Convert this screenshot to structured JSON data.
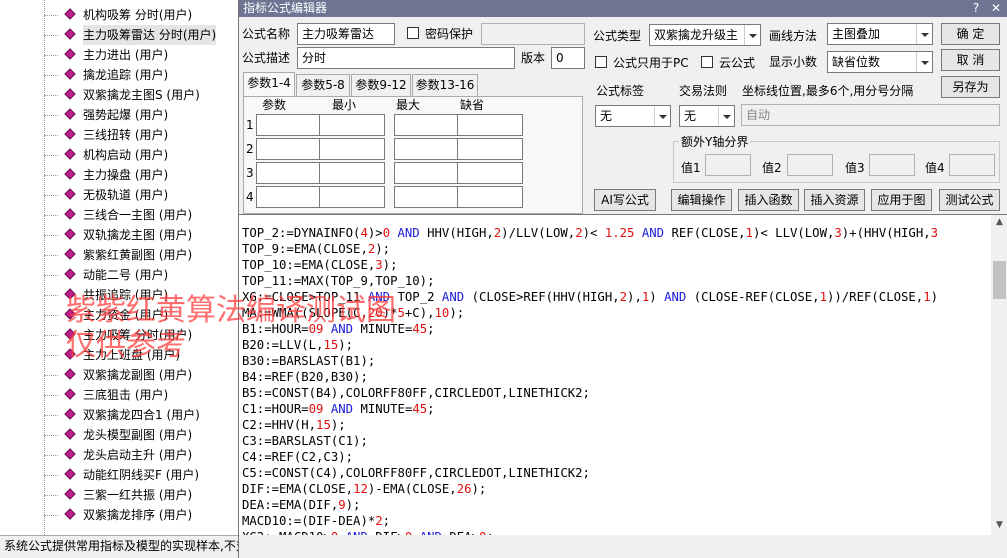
{
  "tree": {
    "items": [
      {
        "label": "机构吸筹  分时(用户)"
      },
      {
        "label": "主力吸筹雷达  分时(用户)",
        "selected": true
      },
      {
        "label": "主力进出  (用户)"
      },
      {
        "label": "擒龙追踪  (用户)"
      },
      {
        "label": "双紫擒龙主图S  (用户)"
      },
      {
        "label": "强势起爆  (用户)"
      },
      {
        "label": "三线扭转  (用户)"
      },
      {
        "label": "机构启动  (用户)"
      },
      {
        "label": "主力操盘  (用户)"
      },
      {
        "label": "无极轨道  (用户)"
      },
      {
        "label": "三线合一主图  (用户)"
      },
      {
        "label": "双轨擒龙主图  (用户)"
      },
      {
        "label": "紫紫红黄副图  (用户)"
      },
      {
        "label": "动能二号  (用户)"
      },
      {
        "label": "共振追踪  (用户)"
      },
      {
        "label": "主力资金  (用户)"
      },
      {
        "label": "主力吸筹  分时(用户)"
      },
      {
        "label": "主力上班盘  (用户)"
      },
      {
        "label": "双紫擒龙副图  (用户)"
      },
      {
        "label": "三底狙击  (用户)"
      },
      {
        "label": "双紫擒龙四合1  (用户)"
      },
      {
        "label": "龙头模型副图  (用户)"
      },
      {
        "label": "龙头启动主升  (用户)"
      },
      {
        "label": "动能红阴线买F  (用户)"
      },
      {
        "label": "三紫一红共振  (用户)"
      },
      {
        "label": "双紫擒龙排序  (用户)"
      }
    ],
    "status": "系统公式提供常用指标及模型的实现样本,不对"
  },
  "window": {
    "title": "指标公式编辑器",
    "help_icon": "question-mark",
    "close_icon": "close-x"
  },
  "form": {
    "name_label": "公式名称",
    "name_value": "主力吸筹雷达",
    "password_label": "密码保护",
    "password_value": "",
    "desc_label": "公式描述",
    "desc_value": "分时",
    "version_label": "版本",
    "version_value": "0",
    "type_label": "公式类型",
    "type_value": "双紫擒龙升级主",
    "draw_label": "画线方法",
    "draw_value": "主图叠加",
    "pc_only_label": "公式只用于PC",
    "cloud_label": "云公式",
    "decimals_label": "显示小数",
    "decimals_value": "缺省位数",
    "confirm": "确  定",
    "cancel": "取  消",
    "save_as": "另存为"
  },
  "tabs": [
    "参数1-4",
    "参数5-8",
    "参数9-12",
    "参数13-16"
  ],
  "params": {
    "headers": [
      "参数",
      "最小",
      "最大",
      "缺省"
    ],
    "rows": [
      "1",
      "2",
      "3",
      "4"
    ]
  },
  "right": {
    "tag_label": "公式标签",
    "tag_value": "无",
    "trade_label": "交易法则",
    "trade_value": "无",
    "coord_label": "坐标线位置,最多6个,用分号分隔",
    "coord_value": "自动",
    "yaxis_label": "额外Y轴分界",
    "y1": "值1",
    "y2": "值2",
    "y3": "值3",
    "y4": "值4"
  },
  "toolbar": {
    "ai": "AI写公式",
    "edit": "编辑操作",
    "insert_func": "插入函数",
    "insert_res": "插入资源",
    "apply": "应用于图",
    "test": "测试公式"
  },
  "code": [
    [
      [
        "TOP_2:=DYNAINFO(",
        ""
      ],
      [
        "4",
        "n"
      ],
      [
        ")>",
        ""
      ],
      [
        "0",
        "n"
      ],
      [
        " AND ",
        "k"
      ],
      [
        "HHV(HIGH,",
        ""
      ],
      [
        "2",
        "n"
      ],
      [
        ")/LLV(LOW,",
        ""
      ],
      [
        "2",
        "n"
      ],
      [
        ")< ",
        ""
      ],
      [
        "1.25",
        "n"
      ],
      [
        " AND ",
        "k"
      ],
      [
        "REF(CLOSE,",
        ""
      ],
      [
        "1",
        "n"
      ],
      [
        ")< LLV(LOW,",
        ""
      ],
      [
        "3",
        "n"
      ],
      [
        ")+(HHV(HIGH,",
        ""
      ],
      [
        "3",
        "n"
      ]
    ],
    [
      [
        "TOP_9:=EMA(CLOSE,",
        ""
      ],
      [
        "2",
        "n"
      ],
      [
        ");",
        ""
      ]
    ],
    [
      [
        "TOP_10:=EMA(CLOSE,",
        ""
      ],
      [
        "3",
        "n"
      ],
      [
        ");",
        ""
      ]
    ],
    [
      [
        "TOP_11:=MAX(TOP_9,TOP_10);",
        ""
      ]
    ],
    [
      [
        "XG:=CLOSE>TOP_11",
        ""
      ],
      [
        " AND ",
        "k"
      ],
      [
        "TOP_2",
        ""
      ],
      [
        " AND ",
        "k"
      ],
      [
        "(CLOSE>REF(HHV(HIGH,",
        ""
      ],
      [
        "2",
        "n"
      ],
      [
        "),",
        ""
      ],
      [
        "1",
        "n"
      ],
      [
        ")",
        ""
      ],
      [
        " AND ",
        "k"
      ],
      [
        "(CLOSE-REF(CLOSE,",
        ""
      ],
      [
        "1",
        "n"
      ],
      [
        "))/REF(CLOSE,",
        ""
      ],
      [
        "1",
        "n"
      ],
      [
        ")",
        ""
      ]
    ],
    [
      [
        "MA:=WMA((SLOPE(C,",
        ""
      ],
      [
        "20",
        "n"
      ],
      [
        ")*",
        ""
      ],
      [
        "5",
        "n"
      ],
      [
        "+C),",
        ""
      ],
      [
        "10",
        "n"
      ],
      [
        ");",
        ""
      ]
    ],
    [
      [
        "B1:=HOUR=",
        ""
      ],
      [
        "09",
        "n"
      ],
      [
        " AND ",
        "k"
      ],
      [
        "MINUTE=",
        ""
      ],
      [
        "45",
        "n"
      ],
      [
        ";",
        ""
      ]
    ],
    [
      [
        "B20:=LLV(L,",
        ""
      ],
      [
        "15",
        "n"
      ],
      [
        ");",
        ""
      ]
    ],
    [
      [
        "B30:=BARSLAST(B1);",
        ""
      ]
    ],
    [
      [
        "B4:=REF(B20,B30);",
        ""
      ]
    ],
    [
      [
        "B5:=CONST(B4),COLORFF80FF,CIRCLEDOT,LINETHICK2;",
        ""
      ]
    ],
    [
      [
        "C1:=HOUR=",
        ""
      ],
      [
        "09",
        "n"
      ],
      [
        " AND ",
        "k"
      ],
      [
        "MINUTE=",
        ""
      ],
      [
        "45",
        "n"
      ],
      [
        ";",
        ""
      ]
    ],
    [
      [
        "C2:=HHV(H,",
        ""
      ],
      [
        "15",
        "n"
      ],
      [
        ");",
        ""
      ]
    ],
    [
      [
        "C3:=BARSLAST(C1);",
        ""
      ]
    ],
    [
      [
        "C4:=REF(C2,C3);",
        ""
      ]
    ],
    [
      [
        "C5:=CONST(C4),COLORFF80FF,CIRCLEDOT,LINETHICK2;",
        ""
      ]
    ],
    [
      [
        "DIF:=EMA(CLOSE,",
        ""
      ],
      [
        "12",
        "n"
      ],
      [
        ")-EMA(CLOSE,",
        ""
      ],
      [
        "26",
        "n"
      ],
      [
        ");",
        ""
      ]
    ],
    [
      [
        "DEA:=EMA(DIF,",
        ""
      ],
      [
        "9",
        "n"
      ],
      [
        ");",
        ""
      ]
    ],
    [
      [
        "MACD10:=(DIF-DEA)*",
        ""
      ],
      [
        "2",
        "n"
      ],
      [
        ";",
        ""
      ]
    ],
    [
      [
        "XG2:=MACD10>",
        ""
      ],
      [
        "0",
        "n"
      ],
      [
        " AND ",
        "k"
      ],
      [
        "DIF>",
        ""
      ],
      [
        "0",
        "n"
      ],
      [
        " AND ",
        "k"
      ],
      [
        "DEA>",
        ""
      ],
      [
        "0",
        "n"
      ],
      [
        ";",
        ""
      ]
    ]
  ],
  "watermark": {
    "line1": "紫紫红黄算法编译测试图",
    "line2": "仅供参考"
  },
  "colors": {
    "titlebar": "#6d7593",
    "keyword": "#1a1ad8",
    "number": "#e01010",
    "watermark": "#ff3c3c"
  }
}
